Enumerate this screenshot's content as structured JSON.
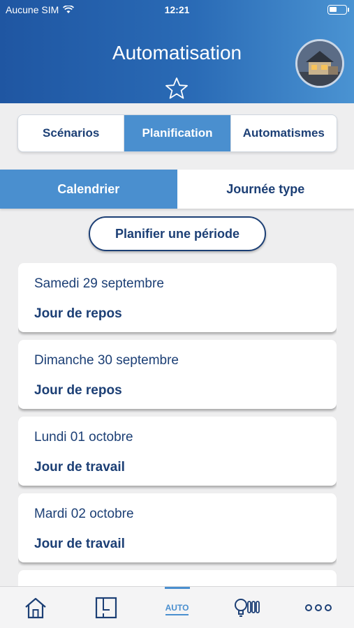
{
  "status": {
    "carrier": "Aucune SIM",
    "time": "12:21"
  },
  "header": {
    "title": "Automatisation"
  },
  "segments": [
    "Scénarios",
    "Planification",
    "Automatismes"
  ],
  "subtabs": [
    "Calendrier",
    "Journée type"
  ],
  "plan_button": "Planifier une période",
  "days": [
    {
      "date": "Samedi 29 septembre",
      "type": "Jour de repos"
    },
    {
      "date": "Dimanche 30 septembre",
      "type": "Jour de repos"
    },
    {
      "date": "Lundi 01 octobre",
      "type": "Jour de travail"
    },
    {
      "date": "Mardi 02 octobre",
      "type": "Jour de travail"
    }
  ],
  "tabbar": {
    "auto_label": "AUTO"
  },
  "colors": {
    "primary": "#1c3f75",
    "accent": "#4a8fcf"
  }
}
